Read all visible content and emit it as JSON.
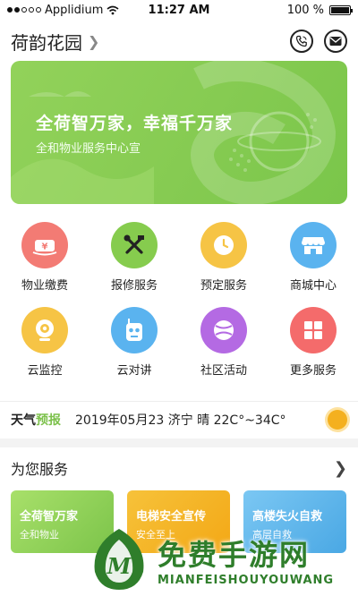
{
  "status_bar": {
    "carrier": "Applidium",
    "time": "11:27 AM",
    "battery": "100 %"
  },
  "header": {
    "title": "荷韵花园"
  },
  "banner": {
    "title": "全荷智万家，幸福千万家",
    "subtitle": "全和物业服务中心宣"
  },
  "services": [
    {
      "label": "物业缴费",
      "icon": "wallet-icon",
      "color": "#f37b74"
    },
    {
      "label": "报修服务",
      "icon": "tools-icon",
      "color": "#86cc4e"
    },
    {
      "label": "预定服务",
      "icon": "clock-icon",
      "color": "#f6c445"
    },
    {
      "label": "商城中心",
      "icon": "store-icon",
      "color": "#5ab3ef"
    },
    {
      "label": "云监控",
      "icon": "camera-icon",
      "color": "#f6c445"
    },
    {
      "label": "云对讲",
      "icon": "walkie-talkie-icon",
      "color": "#5ab3ef"
    },
    {
      "label": "社区活动",
      "icon": "ball-icon",
      "color": "#b46ae3"
    },
    {
      "label": "更多服务",
      "icon": "grid-icon",
      "color": "#f46b6b"
    }
  ],
  "weather": {
    "brand_part1": "天气",
    "brand_part2": "预报",
    "text": "2019年05月23  济宁  晴 22C°~34C°",
    "icon": "sun-icon"
  },
  "for_you": {
    "title": "为您服务"
  },
  "cards": [
    {
      "title": "全荷智万家",
      "subtitle": "全和物业"
    },
    {
      "title": "电梯安全宣传",
      "subtitle": "安全至上"
    },
    {
      "title": "高楼失火自救",
      "subtitle": "高层自救"
    }
  ],
  "watermark": {
    "main": "免费手游网",
    "sub": "MIANFEISHOUYOUWANG"
  }
}
